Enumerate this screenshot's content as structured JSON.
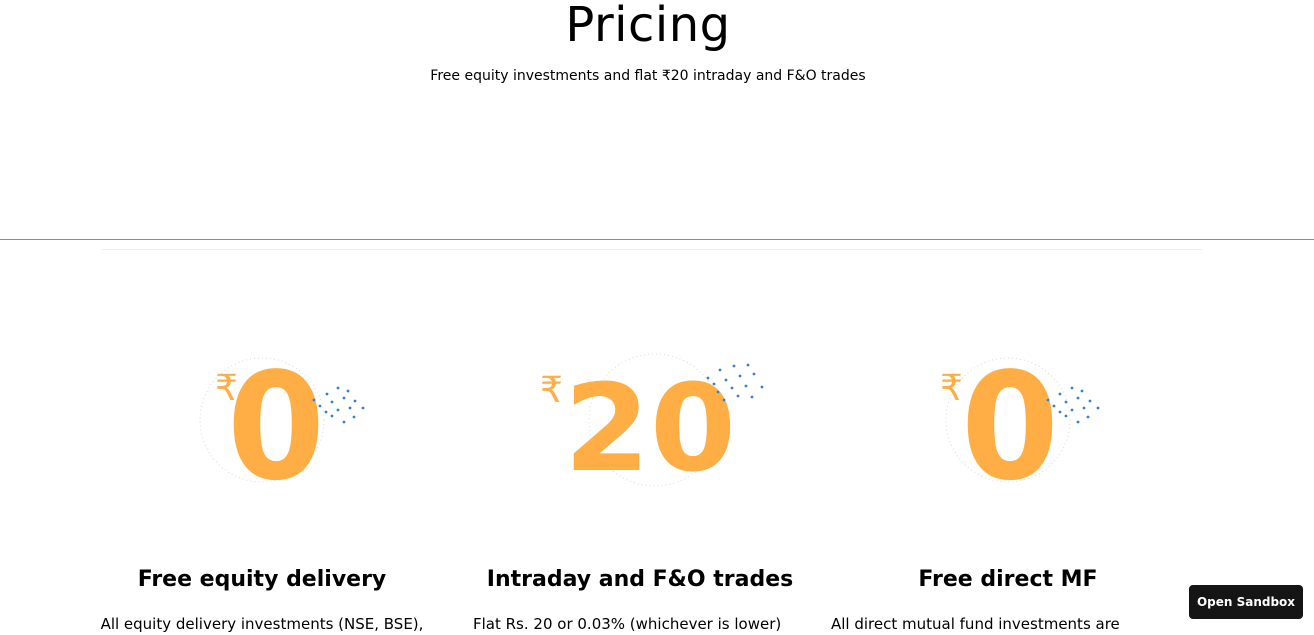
{
  "header": {
    "title": "Pricing",
    "subtitle": "Free equity investments and flat ₹20 intraday and F&O trades"
  },
  "cards": [
    {
      "currency_symbol": "₹",
      "amount": "0",
      "title": "Free equity delivery",
      "description": "All equity delivery investments (NSE, BSE),"
    },
    {
      "currency_symbol": "₹",
      "amount": "20",
      "title": "Intraday and F&O trades",
      "description": "Flat Rs. 20 or 0.03% (whichever is lower)"
    },
    {
      "currency_symbol": "₹",
      "amount": "0",
      "title": "Free direct MF",
      "description": "All direct mutual fund investments are"
    }
  ],
  "sandbox_button": {
    "label": "Open Sandbox"
  },
  "colors": {
    "accent_orange": "#FFAE45",
    "dot_blue": "#387ED1",
    "button_dark": "#151515"
  }
}
